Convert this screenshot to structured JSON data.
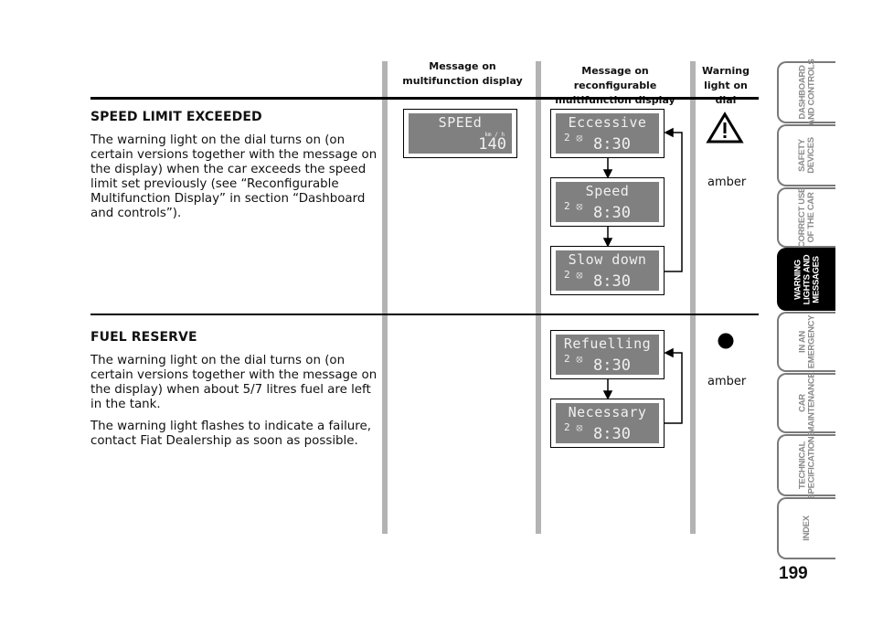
{
  "columns": {
    "multifunction": "Message on\nmultifunction display",
    "multifunction_l1": "Message on",
    "multifunction_l2": "multifunction display",
    "reconfigurable_l1": "Message on reconfigurable",
    "reconfigurable_l2": "multifunction display",
    "warning_l1": "Warning",
    "warning_l2": "light on dial"
  },
  "sections": [
    {
      "title": "SPEED LIMIT EXCEEDED",
      "paragraphs": [
        "The warning light on the dial turns on (on certain versions together with the message on the display) when the car exceeds the speed limit set previously (see “Reconfigurable Multifunction Display” in section “Dashboard and controls”)."
      ],
      "multifunction_display": {
        "message": "SPEEd",
        "unit": "km / h",
        "value": "140"
      },
      "reconfigurable_display": [
        {
          "message": "Eccessive",
          "gear": "2",
          "time": "8:30"
        },
        {
          "message": "Speed",
          "gear": "2",
          "time": "8:30"
        },
        {
          "message": "Slow down",
          "gear": "2",
          "time": "8:30"
        }
      ],
      "warning_icon": "warning-triangle-icon",
      "warning_color": "amber"
    },
    {
      "title": "FUEL RESERVE",
      "paragraphs": [
        "The warning light on the dial turns on (on certain versions together with the message on the display) when about 5/7 litres fuel are left in the tank.",
        "The warning light flashes to indicate a failure, contact Fiat Dealership as soon as possible."
      ],
      "reconfigurable_display": [
        {
          "message": "Refuelling",
          "gear": "2",
          "time": "8:30"
        },
        {
          "message": "Necessary",
          "gear": "2",
          "time": "8:30"
        }
      ],
      "warning_icon": "filled-circle-icon",
      "warning_color": "amber"
    }
  ],
  "side_tabs": [
    {
      "label_l1": "DASHBOARD",
      "label_l2": "AND CONTROLS",
      "active": false
    },
    {
      "label_l1": "SAFETY",
      "label_l2": "DEVICES",
      "active": false
    },
    {
      "label_l1": "CORRECT USE",
      "label_l2": "OF THE CAR",
      "active": false
    },
    {
      "label_l1": "WARNING",
      "label_l2": "LIGHTS AND",
      "label_l3": "MESSAGES",
      "active": true
    },
    {
      "label_l1": "IN AN",
      "label_l2": "EMERGENCY",
      "active": false
    },
    {
      "label_l1": "CAR",
      "label_l2": "MAINTENANCE",
      "active": false
    },
    {
      "label_l1": "TECHNICAL",
      "label_l2": "SPECIFICATIONS",
      "active": false
    },
    {
      "label_l1": "INDEX",
      "active": false
    }
  ],
  "page_number": "199"
}
